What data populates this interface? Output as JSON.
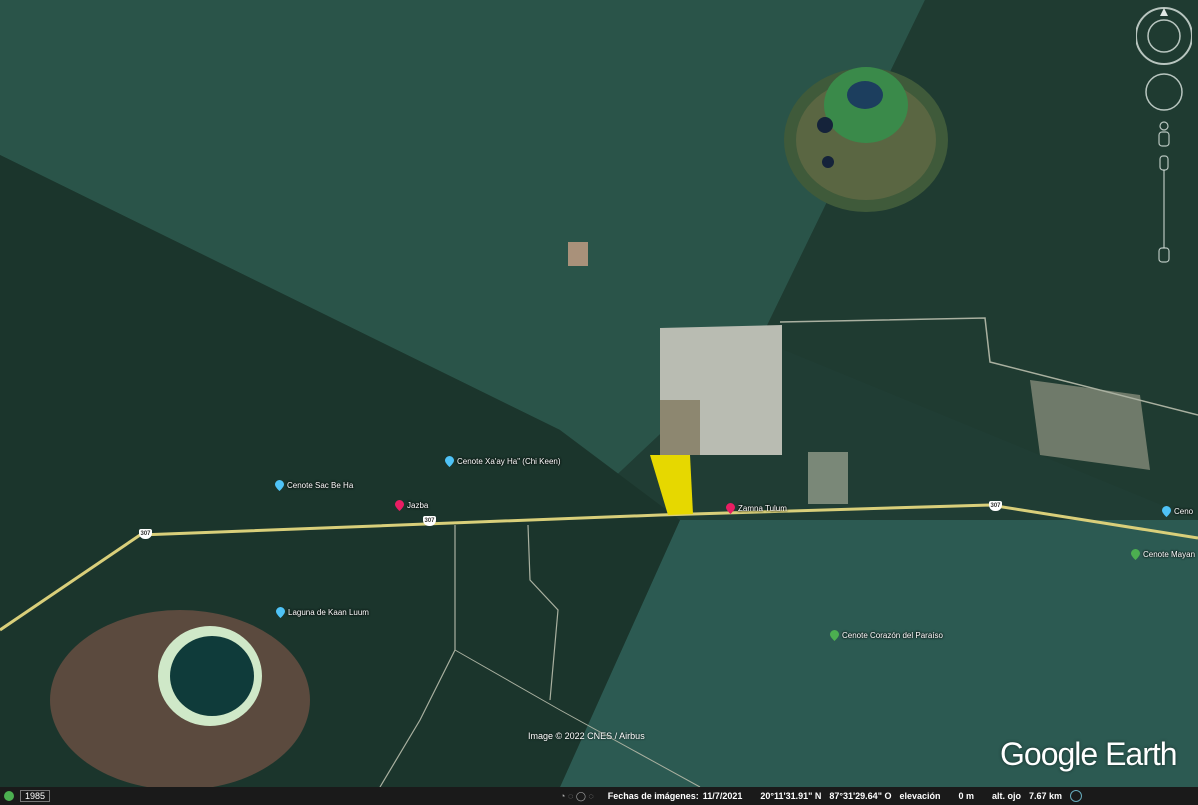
{
  "app": "Google Earth",
  "pois": [
    {
      "id": "sac-be-ha",
      "label": "Cenote Sac Be Ha",
      "type": "cenote",
      "color": "#4fc3f7"
    },
    {
      "id": "xaay-ha",
      "label": "Cenote Xa'ay Ha\" (Chi Keen)",
      "type": "cenote",
      "color": "#4fc3f7"
    },
    {
      "id": "jazba",
      "label": "Jazba",
      "type": "hotel",
      "color": "#e91e63"
    },
    {
      "id": "zamna",
      "label": "Zamna Tulum",
      "type": "hotel",
      "color": "#e91e63"
    },
    {
      "id": "kaan-luum",
      "label": "Laguna de Kaan Luum",
      "type": "lake",
      "color": "#4fc3f7"
    },
    {
      "id": "corazon",
      "label": "Cenote Corazón del Paraíso",
      "type": "park",
      "color": "#4caf50"
    },
    {
      "id": "mayan",
      "label": "Cenote Mayan",
      "type": "park",
      "color": "#4caf50"
    },
    {
      "id": "cenote-edge",
      "label": "Ceno",
      "type": "cenote",
      "color": "#4fc3f7"
    }
  ],
  "road_shield": "307",
  "credit": "Image © 2022 CNES / Airbus",
  "logo": {
    "google": "Google",
    "earth": "Earth"
  },
  "status": {
    "year": "1985",
    "dates_label": "Fechas de imágenes:",
    "date": "11/7/2021",
    "lat": "20°11'31.91\" N",
    "lon": "87°31'29.64\" O",
    "elev_label": "elevación",
    "elev": "0 m",
    "eye_label": "alt. ojo",
    "eye": "7.67 km"
  },
  "colors": {
    "highlight": "#e6d800",
    "road": "#d9cf7a"
  }
}
